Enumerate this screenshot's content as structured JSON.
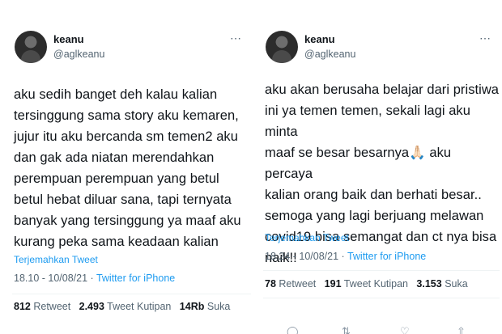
{
  "tweets": [
    {
      "display_name": "keanu",
      "handle": "@aglkeanu",
      "text": "aku sedih banget deh kalau kalian\ntersinggung sama story aku kemaren,\njujur itu aku bercanda sm temen2 aku\ndan gak ada niatan merendahkan\nperempuan perempuan yang betul\nbetul hebat diluar sana, tapi ternyata\nbanyak yang tersinggung ya maaf aku\nkurang peka sama keadaan kalian",
      "translate_label": "Terjemahkan Tweet",
      "time": "18.10",
      "date": "10/08/21",
      "separator": " · ",
      "source": "Twitter for iPhone",
      "stats": {
        "retweets": "812",
        "retweets_label": "Retweet",
        "quotes": "2.493",
        "quotes_label": "Tweet Kutipan",
        "likes": "14Rb",
        "likes_label": "Suka"
      },
      "more_icon": "more-dots-icon"
    },
    {
      "display_name": "keanu",
      "handle": "@aglkeanu",
      "text": "aku akan berusaha belajar dari pristiwa\nini ya temen temen, sekali lagi aku minta\nmaaf se besar besarnya🙏🏻 aku percaya\nkalian orang baik dan berhati besar..\nsemoga yang lagi berjuang melawan\ncovid19 bisa semangat dan ct nya bisa\nnaik!!",
      "translate_label": "Terjemahkan Tweet",
      "time": "18.24",
      "date": "10/08/21",
      "separator": " · ",
      "source": "Twitter for iPhone",
      "stats": {
        "retweets": "78",
        "retweets_label": "Retweet",
        "quotes": "191",
        "quotes_label": "Tweet Kutipan",
        "likes": "3.153",
        "likes_label": "Suka"
      },
      "more_icon": "more-dots-icon",
      "action_icons": [
        "reply-icon",
        "retweet-icon",
        "like-icon",
        "share-icon"
      ]
    }
  ]
}
